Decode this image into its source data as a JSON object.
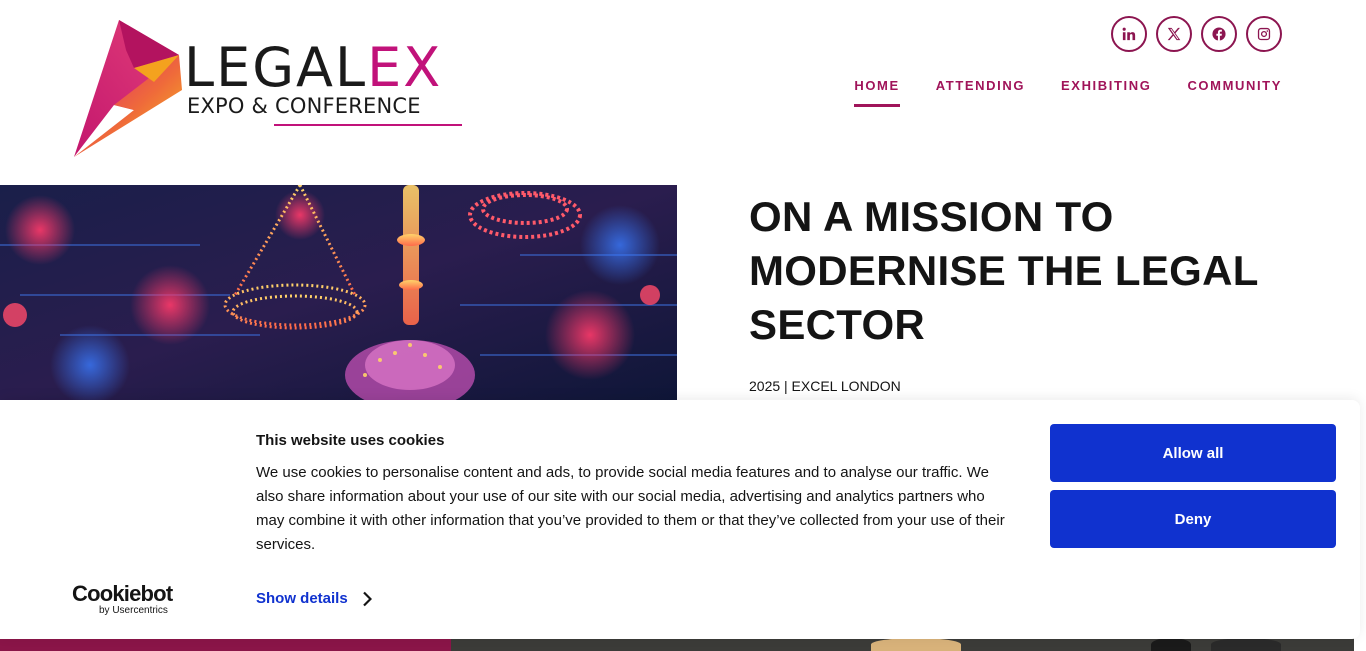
{
  "logo": {
    "word_main": "LEGAL",
    "word_accent": "EX",
    "subtitle": "EXPO & CONFERENCE",
    "colors": {
      "pink": "#c1127a",
      "orange": "#f39a1f",
      "yellow": "#f5c518",
      "dark": "#1a1a1a"
    }
  },
  "social": [
    {
      "name": "linkedin-icon",
      "glyph": "in"
    },
    {
      "name": "x-icon",
      "glyph": "X"
    },
    {
      "name": "facebook-icon",
      "glyph": "f"
    },
    {
      "name": "instagram-icon",
      "glyph": "ig"
    }
  ],
  "nav": {
    "items": [
      {
        "label": "HOME",
        "active": true
      },
      {
        "label": "ATTENDING",
        "active": false
      },
      {
        "label": "EXHIBITING",
        "active": false
      },
      {
        "label": "COMMUNITY",
        "active": false
      }
    ],
    "color": "#a0145a"
  },
  "hero": {
    "title": "ON A MISSION TO MODERNISE THE LEGAL SECTOR",
    "subtitle": "2025 | EXCEL LONDON"
  },
  "cookie": {
    "brand": "Cookiebot",
    "brand_by": "by Usercentrics",
    "title": "This website uses cookies",
    "text": "We use cookies to personalise content and ads, to provide social media features and to analyse our traffic. We also share information about your use of our site with our social media, advertising and analytics partners who may combine it with other information that you’ve provided to them or that they’ve collected from your use of their services.",
    "show_details": "Show details",
    "allow_all": "Allow all",
    "deny": "Deny",
    "accent": "#1032cf"
  }
}
